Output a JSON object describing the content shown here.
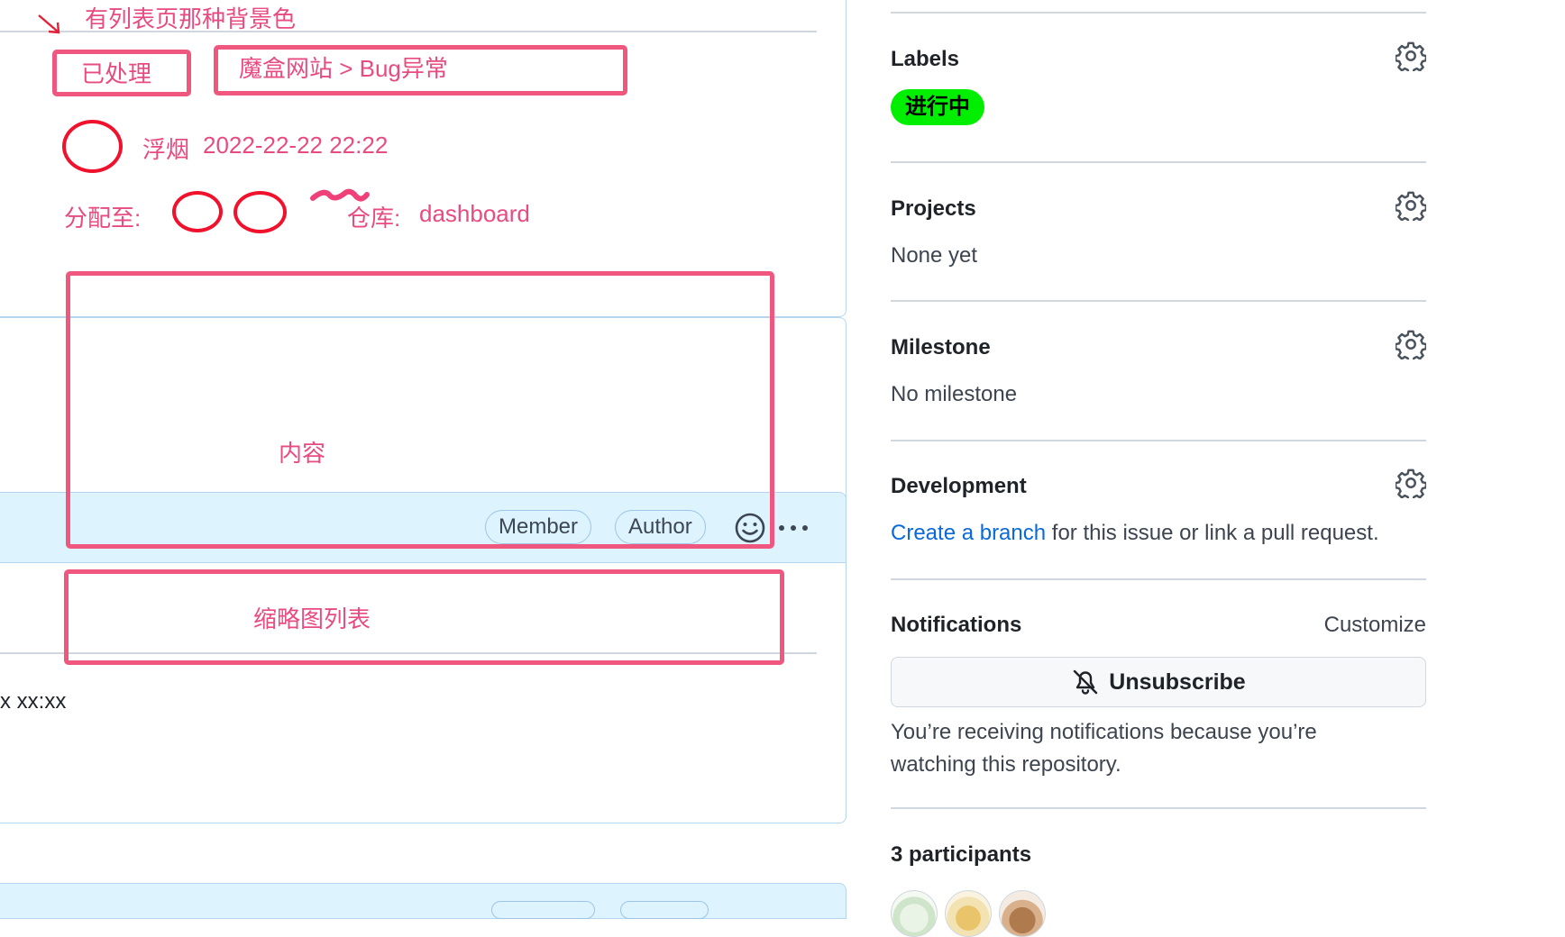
{
  "annotations": {
    "note_background": "有列表页那种背景色",
    "status": "已处理",
    "breadcrumb": "魔盒网站 > Bug异常",
    "author_name": "浮烟",
    "author_time": "2022-22-22 22:22",
    "assign_label": "分配至:",
    "repo_label": "仓库:",
    "repo_name": "dashboard",
    "content": "内容",
    "thumbnails": "缩略图列表"
  },
  "comment": {
    "badge_member": "Member",
    "badge_author": "Author",
    "timestamp_fragment": "x xx:xx"
  },
  "sidebar": {
    "labels": {
      "heading": "Labels",
      "label": "进行中",
      "label_color": "#00ee00"
    },
    "projects": {
      "heading": "Projects",
      "value": "None yet"
    },
    "milestone": {
      "heading": "Milestone",
      "value": "No milestone"
    },
    "development": {
      "heading": "Development",
      "link_text": "Create a branch",
      "rest_text": " for this issue or link a pull request."
    },
    "notifications": {
      "heading": "Notifications",
      "customize": "Customize",
      "button_label": "Unsubscribe",
      "desc_line1": "You’re receiving notifications because you’re",
      "desc_line2": "watching this repository."
    },
    "participants": {
      "heading": "3 participants",
      "count": 3
    }
  },
  "colors": {
    "annotation_pink": "#f0577f",
    "annotation_red": "#f0122c",
    "accent_link": "#0969da",
    "comment_header_bg": "#ddf4ff"
  },
  "icons": [
    "gear-icon",
    "bell-slash-icon",
    "smiley-icon",
    "kebab-icon",
    "red-arrow-icon"
  ]
}
